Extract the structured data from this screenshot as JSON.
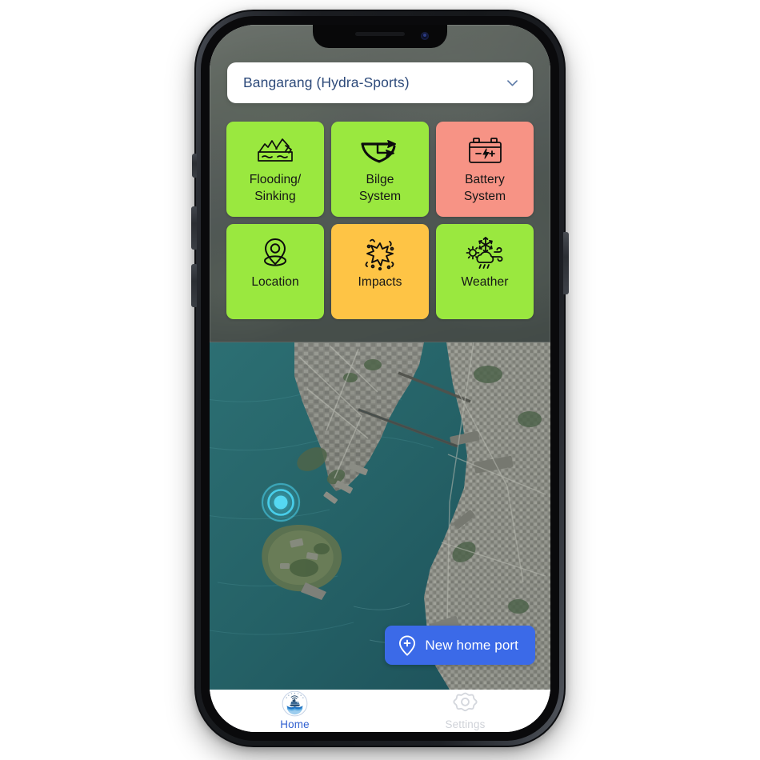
{
  "app": {
    "platform": "ios-phone",
    "screen_background": "#ffffff"
  },
  "vessel_selector": {
    "name": "vessel-dropdown",
    "value": "Bangarang (Hydra-Sports)",
    "placeholder": "Select vessel",
    "icon": "chevron-down-icon",
    "text_color": "#2d4a7a"
  },
  "status_tiles": [
    {
      "id": "flooding-sinking",
      "label": "Flooding/\nSinking",
      "icon": "sinking-boat-icon",
      "status": "ok",
      "color": "#9ae83f"
    },
    {
      "id": "bilge-system",
      "label": "Bilge\nSystem",
      "icon": "bilge-pump-icon",
      "status": "ok",
      "color": "#9ae83f"
    },
    {
      "id": "battery-system",
      "label": "Battery\nSystem",
      "icon": "battery-icon",
      "status": "alert",
      "color": "#f79385"
    },
    {
      "id": "location",
      "label": "Location",
      "icon": "map-pin-icon",
      "status": "ok",
      "color": "#9ae83f"
    },
    {
      "id": "impacts",
      "label": "Impacts",
      "icon": "impact-burst-icon",
      "status": "warning",
      "color": "#fec445"
    },
    {
      "id": "weather",
      "label": "Weather",
      "icon": "weather-mixed-icon",
      "status": "ok",
      "color": "#9ae83f"
    }
  ],
  "map": {
    "name": "satellite-map",
    "view": "satellite",
    "marker": {
      "name": "current-location-marker",
      "icon": "pulsing-location-dot",
      "color": "#4ad3ef"
    },
    "new_home_port_button": {
      "label": "New home port",
      "icon": "map-pin-plus-icon",
      "color": "#3b6ae8"
    }
  },
  "tabbar": {
    "tabs": [
      {
        "id": "home",
        "label": "Home",
        "icon": "boat-signal-logo-icon",
        "active": true,
        "color": "#2f5fd0"
      },
      {
        "id": "settings",
        "label": "Settings",
        "icon": "gear-icon",
        "active": false,
        "color": "#cfd2d8"
      }
    ]
  }
}
